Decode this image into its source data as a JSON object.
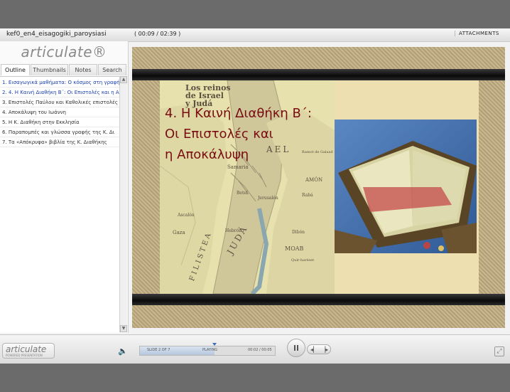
{
  "window": {
    "file_title": "kef0_en4_eisagogiki_paroysiasi",
    "time_display": "( 00:09 / 02:39 )",
    "attachments_label": "ATTACHMENTS"
  },
  "sidebar": {
    "logo_text": "articulate®",
    "tabs": [
      {
        "label": "Outline",
        "active": true
      },
      {
        "label": "Thumbnails",
        "active": false
      },
      {
        "label": "Notes",
        "active": false
      },
      {
        "label": "Search",
        "active": false
      }
    ],
    "outline_items": [
      {
        "label": "1. Εισαγωγικά μαθήματα: Ο κόσμος στη γραφή"
      },
      {
        "label": "2. 4. Η Καινή Διαθήκη Β΄: Οι Επιστολές και η Α"
      },
      {
        "label": "3. Επιστολές Παύλου και Καθολικές επιστολές"
      },
      {
        "label": "4. Αποκάλυψη του Ιωάννη"
      },
      {
        "label": "5. Η Κ. Διαθήκη στην Εκκλησία"
      },
      {
        "label": "6. Παραπομπές και γλώσσα γραφής της Κ. Δι"
      },
      {
        "label": "7. Τα «Απόκρυφα» βιβλία της Κ. Διαθήκης"
      }
    ]
  },
  "slide": {
    "title_lines": [
      "4. Η Καινή Διαθήκη Β΄:",
      "Οι Επιστολές και",
      "η Αποκάλυψη"
    ],
    "title_color": "#7a0d12",
    "map_labels": {
      "header_1": "Los reinos",
      "header_2": "de Israel",
      "header_3": "y Judá",
      "samaria": "Samaria",
      "betel": "Betel",
      "jerusalen": "Jerusalén",
      "hebron": "Hebrón",
      "gaza": "Gaza",
      "ascalon": "Ascalón",
      "judea": "JUDÁ",
      "moab": "MOAB",
      "amon": "AMÓN",
      "filistea": "FILISTEA",
      "israel_partial": "AEL",
      "rabá": "Rabá",
      "dibon": "Dibón",
      "qir": "Quir-haréset",
      "ramot": "Ramot de Galaad"
    }
  },
  "player": {
    "footer_logo": "articulate",
    "footer_logo_sub": "POWERED PRESENTATION",
    "slide_counter": "SLIDE 2 OF 7",
    "status": "PLAYING",
    "slide_time": "00:02 / 00:05",
    "progress_fraction": 0.55
  },
  "colors": {
    "accent_blue": "#1a3fb0",
    "stage_bar": "#111111",
    "page_bg": "#6b6b6b"
  }
}
